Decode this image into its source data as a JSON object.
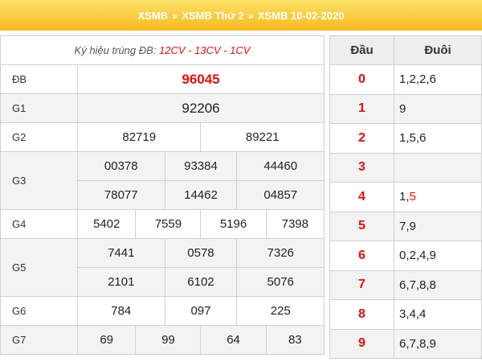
{
  "breadcrumb": {
    "items": [
      "XSMB",
      "XSMB Thứ 2",
      "XSMB 10-02-2020"
    ],
    "separator": "»"
  },
  "results": {
    "symbol_label": "Ký hiệu trúng ĐB: ",
    "symbol_codes": "12CV - 13CV - 1CV",
    "prizes": {
      "db": {
        "label": "ĐB",
        "numbers": [
          "96045"
        ]
      },
      "g1": {
        "label": "G1",
        "numbers": [
          "92206"
        ]
      },
      "g2": {
        "label": "G2",
        "numbers": [
          "82719",
          "89221"
        ]
      },
      "g3": {
        "label": "G3",
        "numbers": [
          "00378",
          "93384",
          "44460",
          "78077",
          "14462",
          "04857"
        ]
      },
      "g4": {
        "label": "G4",
        "numbers": [
          "5402",
          "7559",
          "5196",
          "7398"
        ]
      },
      "g5": {
        "label": "G5",
        "numbers": [
          "7441",
          "0578",
          "7326",
          "2101",
          "6102",
          "5076"
        ]
      },
      "g6": {
        "label": "G6",
        "numbers": [
          "784",
          "097",
          "225"
        ]
      },
      "g7": {
        "label": "G7",
        "numbers": [
          "69",
          "99",
          "64",
          "83"
        ]
      }
    }
  },
  "loto": {
    "head_label": "Đầu",
    "tail_label": "Đuôi",
    "rows": [
      {
        "dau": "0",
        "duoi": "1,2,2,6"
      },
      {
        "dau": "1",
        "duoi": "9"
      },
      {
        "dau": "2",
        "duoi": "1,5,6"
      },
      {
        "dau": "3",
        "duoi": ""
      },
      {
        "dau": "4",
        "duoi_plain": "1,",
        "duoi_red": "5"
      },
      {
        "dau": "5",
        "duoi": "7,9"
      },
      {
        "dau": "6",
        "duoi": "0,2,4,9"
      },
      {
        "dau": "7",
        "duoi": "6,7,8,8"
      },
      {
        "dau": "8",
        "duoi": "3,4,4"
      },
      {
        "dau": "9",
        "duoi": "6,7,8,9"
      }
    ]
  },
  "colors": {
    "title_gradient_top": "#fde26a",
    "title_gradient_bottom": "#f6b91e",
    "special_red": "#e01010"
  }
}
